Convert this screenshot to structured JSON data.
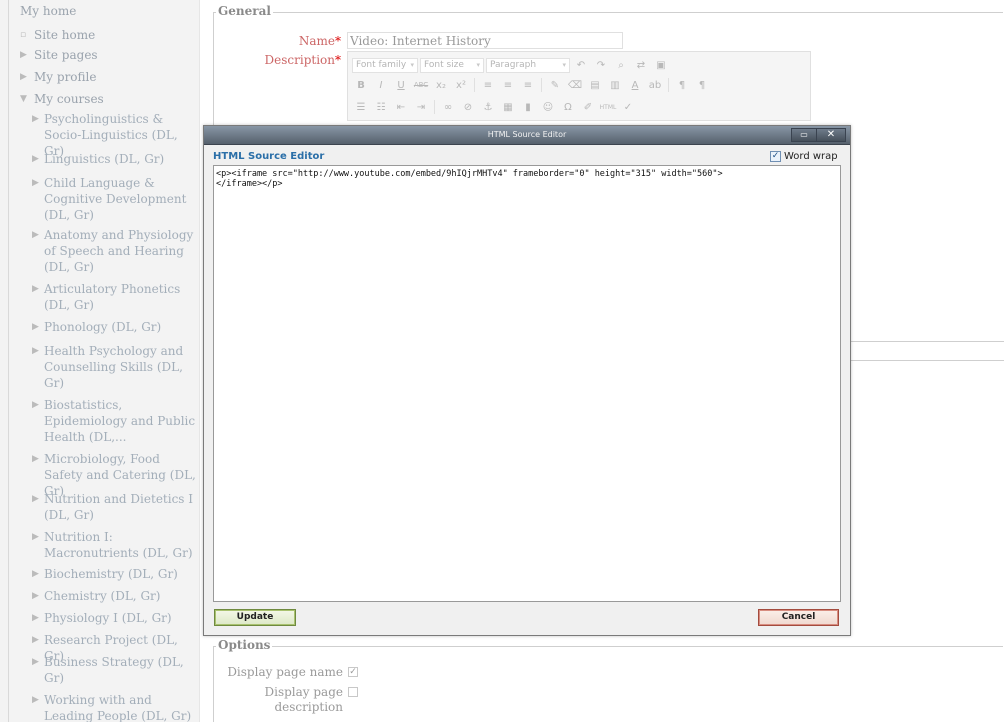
{
  "sidebar": {
    "partial_top": "My home",
    "items": [
      {
        "label": "Site home",
        "mark": "▫"
      },
      {
        "label": "Site pages",
        "mark": "▶"
      },
      {
        "label": "My profile",
        "mark": "▶"
      },
      {
        "label": "My courses",
        "mark": "▼"
      }
    ],
    "courses": [
      "Psycholinguistics & Socio-Linguistics (DL, Gr)",
      "Linguistics (DL, Gr)",
      "Child Language & Cognitive Development (DL, Gr)",
      "Anatomy and Physiology of Speech and Hearing (DL, Gr)",
      "Articulatory Phonetics (DL, Gr)",
      "Phonology (DL, Gr)",
      "Health Psychology and Counselling Skills (DL, Gr)",
      "Biostatistics, Epidemiology and Public Health (DL,...",
      "Microbiology, Food Safety and Catering (DL, Gr)",
      "Nutrition and Dietetics I (DL, Gr)",
      "Nutrition I: Macronutrients (DL, Gr)",
      "Biochemistry (DL, Gr)",
      "Chemistry (DL, Gr)",
      "Physiology I (DL, Gr)",
      "Research Project (DL, Gr)",
      "Business Strategy (DL, Gr)",
      "Working with and Leading People (DL, Gr)"
    ],
    "course_mark": "▶"
  },
  "form": {
    "general_legend": "General",
    "name_label": "Name",
    "name_value": "Video: Internet History",
    "description_label": "Description",
    "required_mark": "*",
    "toolbar": {
      "font_family": "Font family",
      "font_size": "Font size",
      "format": "Paragraph",
      "dropdown_arrow": "▾"
    },
    "options_legend": "Options",
    "display_page_name_label": "Display page name",
    "display_page_name_checked": true,
    "display_page_description_label": "Display page description",
    "display_page_description_checked": false
  },
  "dialog": {
    "title": "HTML Source Editor",
    "heading": "HTML Source Editor",
    "word_wrap_label": "Word wrap",
    "word_wrap_checked": true,
    "source": "<p><iframe src=\"http://www.youtube.com/embed/9hIQjrMHTv4\" frameborder=\"0\" height=\"315\" width=\"560\">\n</iframe></p>",
    "update_label": "Update",
    "cancel_label": "Cancel",
    "minmax_glyph": "▭",
    "close_glyph": "✕"
  },
  "colors": {
    "accent_heading": "#2b6fa8",
    "update_border": "#6f8a3f",
    "cancel_border": "#a34b3e",
    "titlebar": "#56606c"
  }
}
